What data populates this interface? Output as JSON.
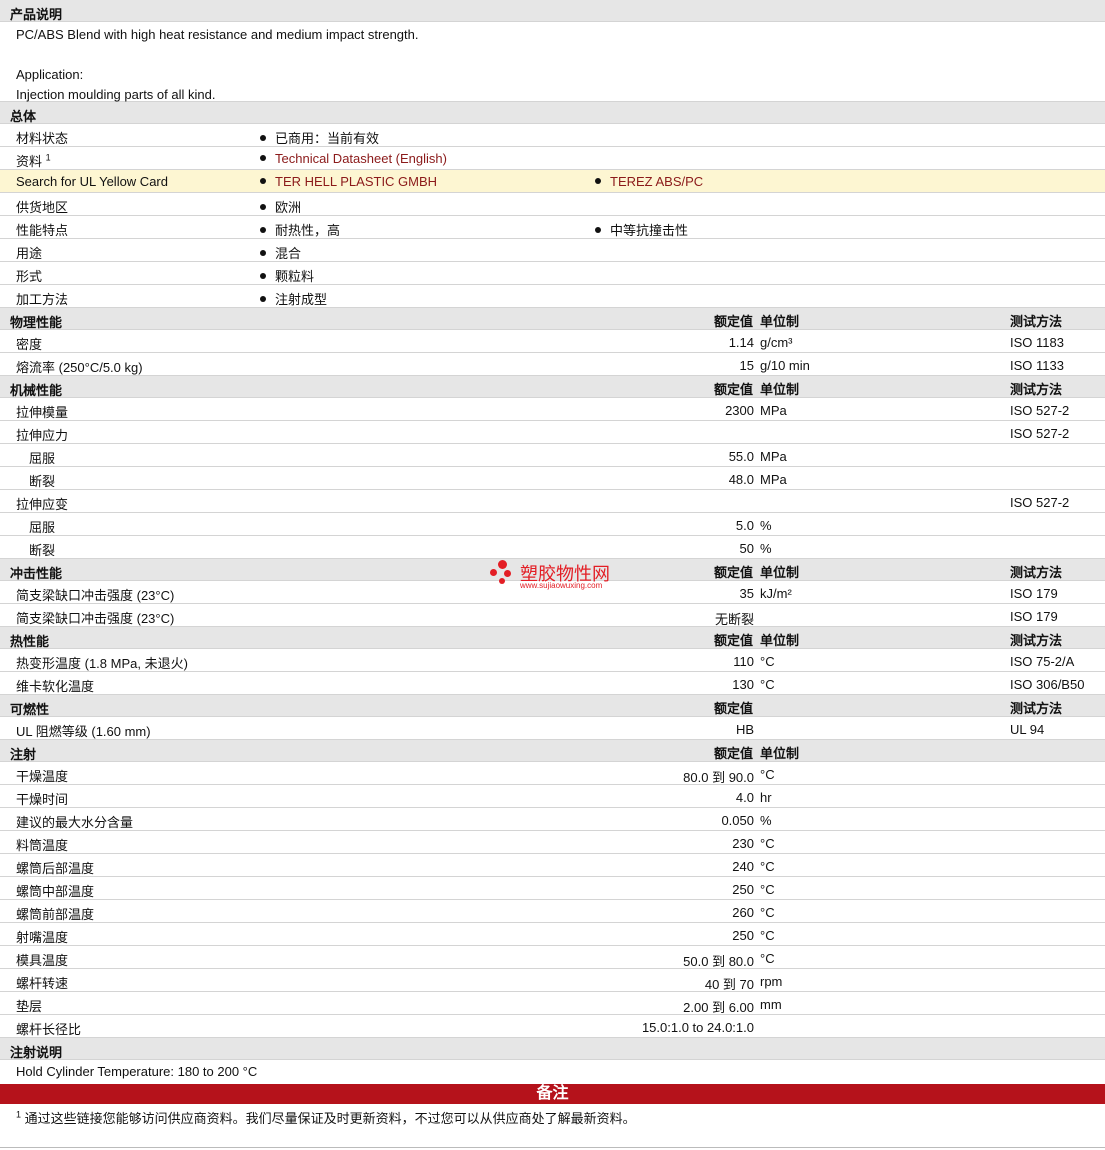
{
  "description": {
    "header": "产品说明",
    "line1": "PC/ABS Blend with high heat resistance and medium impact strength.",
    "line2": "Application:",
    "line3": "Injection moulding parts of all kind."
  },
  "headers": {
    "nominal": "额定值",
    "unit": "单位制",
    "test": "测试方法"
  },
  "general": {
    "title": "总体",
    "status_label": "材料状态",
    "status_value": "已商用：当前有效",
    "source_label": "资料",
    "source_sup": "1",
    "source_value": "Technical Datasheet (English)",
    "ul_label": "Search for UL Yellow Card",
    "ul_v1": "TER HELL PLASTIC GMBH",
    "ul_v2": "TEREZ ABS/PC",
    "region_label": "供货地区",
    "region_value": "欧洲",
    "feature_label": "性能特点",
    "feature_v1": "耐热性，高",
    "feature_v2": "中等抗撞击性",
    "use_label": "用途",
    "use_value": "混合",
    "form_label": "形式",
    "form_value": "颗粒料",
    "process_label": "加工方法",
    "process_value": "注射成型"
  },
  "physical": {
    "title": "物理性能",
    "rows": [
      {
        "label": "密度",
        "value": "1.14",
        "unit": "g/cm³",
        "test": "ISO 1183"
      },
      {
        "label": "熔流率 (250°C/5.0 kg)",
        "value": "15",
        "unit": "g/10 min",
        "test": "ISO 1133"
      }
    ]
  },
  "mechanical": {
    "title": "机械性能",
    "rows": [
      {
        "label": "拉伸模量",
        "value": "2300",
        "unit": "MPa",
        "test": "ISO 527-2"
      },
      {
        "label": "拉伸应力",
        "value": "",
        "unit": "",
        "test": "ISO 527-2"
      },
      {
        "label": "屈服",
        "value": "55.0",
        "unit": "MPa",
        "test": ""
      },
      {
        "label": "断裂",
        "value": "48.0",
        "unit": "MPa",
        "test": ""
      },
      {
        "label": "拉伸应变",
        "value": "",
        "unit": "",
        "test": "ISO 527-2"
      },
      {
        "label": "屈服",
        "value": "5.0",
        "unit": "%",
        "test": ""
      },
      {
        "label": "断裂",
        "value": "50",
        "unit": "%",
        "test": ""
      }
    ]
  },
  "impact": {
    "title": "冲击性能",
    "rows": [
      {
        "label": "简支梁缺口冲击强度 (23°C)",
        "value": "35",
        "unit": "kJ/m²",
        "test": "ISO 179"
      },
      {
        "label": "简支梁缺口冲击强度 (23°C)",
        "value": "无断裂",
        "unit": "",
        "test": "ISO 179"
      }
    ]
  },
  "thermal": {
    "title": "热性能",
    "rows": [
      {
        "label": "热变形温度 (1.8 MPa, 未退火)",
        "value": "110",
        "unit": "°C",
        "test": "ISO 75-2/A"
      },
      {
        "label": "维卡软化温度",
        "value": "130",
        "unit": "°C",
        "test": "ISO 306/B50"
      }
    ]
  },
  "flammability": {
    "title": "可燃性",
    "rows": [
      {
        "label": "UL 阻燃等级 (1.60 mm)",
        "value": "HB",
        "unit": "",
        "test": "UL 94"
      }
    ]
  },
  "injection": {
    "title": "注射",
    "rows": [
      {
        "label": "干燥温度",
        "value": "80.0 到  90.0",
        "unit": "°C"
      },
      {
        "label": "干燥时间",
        "value": "4.0",
        "unit": "hr"
      },
      {
        "label": "建议的最大水分含量",
        "value": "0.050",
        "unit": "%"
      },
      {
        "label": "料筒温度",
        "value": "230",
        "unit": "°C"
      },
      {
        "label": "螺筒后部温度",
        "value": "240",
        "unit": "°C"
      },
      {
        "label": "螺筒中部温度",
        "value": "250",
        "unit": "°C"
      },
      {
        "label": "螺筒前部温度",
        "value": "260",
        "unit": "°C"
      },
      {
        "label": "射嘴温度",
        "value": "250",
        "unit": "°C"
      },
      {
        "label": "模具温度",
        "value": "50.0 到  80.0",
        "unit": "°C"
      },
      {
        "label": "螺杆转速",
        "value": "40 到  70",
        "unit": "rpm"
      },
      {
        "label": "垫层",
        "value": "2.00 到  6.00",
        "unit": "mm"
      },
      {
        "label": "螺杆长径比",
        "value": "15.0:1.0 to 24.0:1.0",
        "unit": ""
      }
    ]
  },
  "injection_notes": {
    "title": "注射说明",
    "text": "Hold Cylinder Temperature: 180 to 200 °C"
  },
  "notes": {
    "title": "备注",
    "footnote_sup": "1",
    "footnote": "通过这些链接您能够访问供应商资料。我们尽量保证及时更新资料，不过您可以从供应商处了解最新资料。"
  },
  "watermark": {
    "text": "塑胶物性网",
    "url": "www.sujiaowuxing.com",
    "color": "#e31e25"
  },
  "colors": {
    "section_bg": "#e6e6e6",
    "highlight_bg": "#fdf6d2",
    "link": "#8b1a1a",
    "notes_bar": "#b5121b"
  }
}
